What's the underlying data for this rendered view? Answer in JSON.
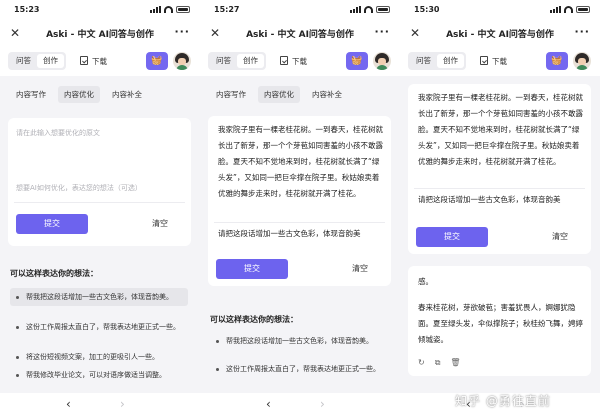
{
  "app": {
    "title": "Aski - 中文 AI问答与创作",
    "mode_tabs": [
      "问答",
      "创作"
    ],
    "download": "下载",
    "content_tabs": [
      "内容写作",
      "内容优化",
      "内容补全"
    ]
  },
  "screens": [
    {
      "time": "15:23",
      "placeholder_text": "请在此输入想要优化的原文",
      "placeholder_idea": "想要AI如何优化，表达您的想法（可选）",
      "submit": "提交",
      "clear": "清空",
      "hint_title": "可以这样表达你的想法：",
      "examples": [
        "帮我把这段话增加一些古文色彩，体现音韵美。",
        "这份工作周报太直白了，帮我表达地更正式一些。",
        "将这份短视频文案，加工的更吸引人一些。",
        "帮我修改毕业论文，可以对语序做适当调整。"
      ]
    },
    {
      "time": "15:27",
      "original": "我家院子里有一棵老桂花树。一到春天，桂花树就长出了新芽，那一个个芽苞如同害羞的小孩不敢露脸。夏天不知不觉地来到时，桂花树就长满了“绿头发”，又如同一把巨伞撑在院子里。秋姑娘卖着优雅的舞步走来时，桂花树就开满了桂花。",
      "idea": "请把这段话增加一些古文色彩，体现音韵美",
      "submit": "提交",
      "clear": "清空",
      "hint_title": "可以这样表达你的想法：",
      "examples": [
        "帮我把这段话增加一些古文色彩，体现音韵美。",
        "这份工作周报太直白了，帮我表达地更正式一些。"
      ]
    },
    {
      "time": "15:30",
      "original": "我家院子里有一棵老桂花树。一到春天，桂花树就长出了新芽，那一个个芽苞如同害羞的小孩不敢露脸。夏天不知不觉地来到时，桂花树就长满了“绿头发”，又如同一把巨伞撑在院子里。秋姑娘卖着优雅的舞步走来时，桂花树就开满了桂花。",
      "idea": "请把这段话增加一些古文色彩，体现音韵美",
      "submit": "提交",
      "clear": "清空",
      "result_lead": "感。",
      "result": "春来桂花树，芽欲破苞；害羞犹畏人，婀娜犹隐面。夏至绿头发，伞似撑院子；秋桂纷飞舞，娉婷倾城姿。"
    }
  ],
  "watermark": "知乎 @勇往直前"
}
